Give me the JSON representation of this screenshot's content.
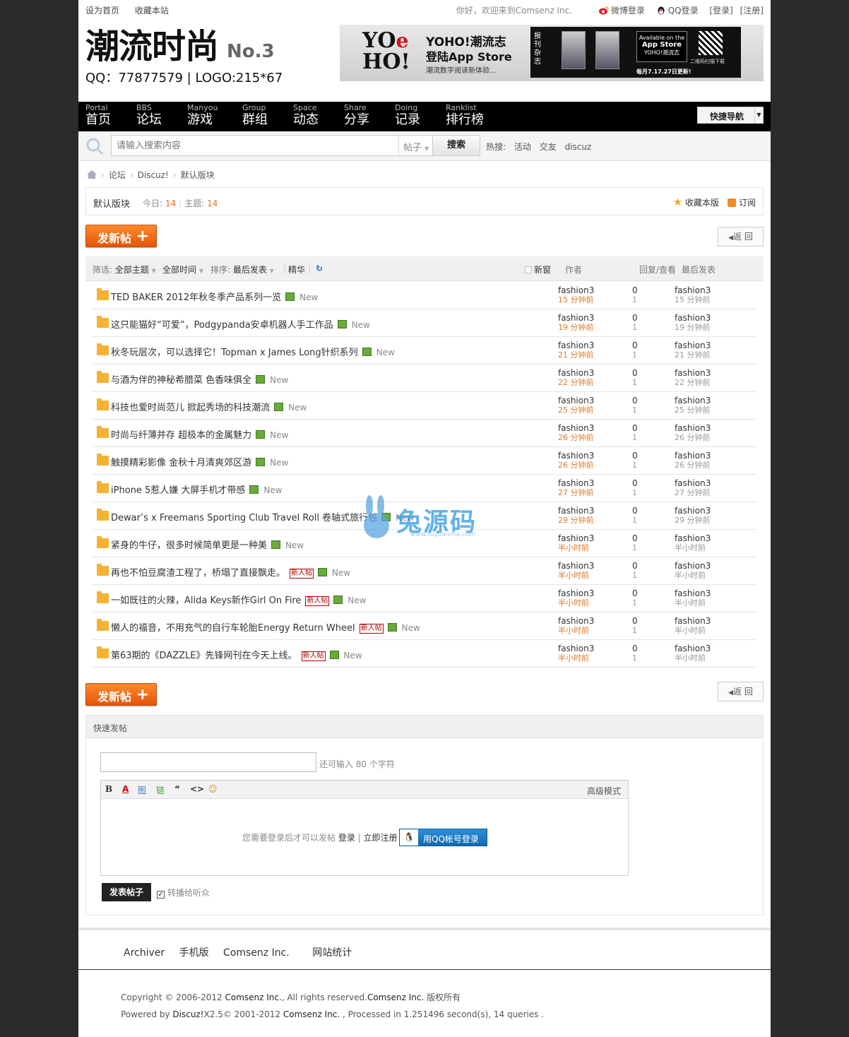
{
  "topbar": {
    "left": [
      "设为首页",
      "收藏本站"
    ],
    "greeting": "你好，欢迎来到Comsenz Inc.",
    "weibo": "微博登录",
    "qq": "QQ登录",
    "login": "[登录]",
    "register": "[注册]"
  },
  "header": {
    "logo_title": "潮流时尚",
    "logo_no": "No.3",
    "logo_sub": "QQ：77877579 | LOGO:215*67"
  },
  "banner": {
    "brand": "YOHO!",
    "line1": "YOHO!潮流志",
    "line2": "登陆App Store",
    "line3": "潮流数字阅读新体验...",
    "vertical": "报刊杂志",
    "app_top": "Available on the",
    "app_store": "App Store",
    "app_name": "YOHO!潮流志",
    "qr_text": "二维码扫描下载",
    "update": "每月7.17.27日更新!"
  },
  "nav": {
    "items": [
      {
        "en": "Portal",
        "cn": "首页"
      },
      {
        "en": "BBS",
        "cn": "论坛"
      },
      {
        "en": "Manyou",
        "cn": "游戏"
      },
      {
        "en": "Group",
        "cn": "群组"
      },
      {
        "en": "Space",
        "cn": "动态"
      },
      {
        "en": "Share",
        "cn": "分享"
      },
      {
        "en": "Doing",
        "cn": "记录"
      },
      {
        "en": "Ranklist",
        "cn": "排行榜"
      }
    ],
    "quick_nav": "快捷导航"
  },
  "search": {
    "placeholder": "请输入搜索内容",
    "type": "帖子",
    "button": "搜索",
    "hot_label": "热搜:",
    "hot": [
      "活动",
      "交友",
      "discuz"
    ]
  },
  "breadcrumb": [
    "论坛",
    "Discuz!",
    "默认版块"
  ],
  "forum": {
    "name": "默认版块",
    "today_label": "今日:",
    "today": "14",
    "threads_label": "主题:",
    "threads": "14",
    "favorite": "收藏本版",
    "subscribe": "订阅"
  },
  "buttons": {
    "new_post": "发新帖",
    "back": "返 回"
  },
  "list_header": {
    "filter_label": "筛选:",
    "filter_all": "全部主题",
    "time_all": "全部时间",
    "sort_label": "排序:",
    "sort_value": "最后发表",
    "digest": "精华",
    "new_window": "新窗",
    "author": "作者",
    "replies_views": "回复/查看",
    "last_post": "最后发表"
  },
  "threads": [
    {
      "title": "TED BAKER 2012年秋冬季产品系列一览",
      "newuser": "",
      "author": "fashion3",
      "time": "15 分钟前",
      "replies": "0",
      "views": "1",
      "last": "fashion3",
      "last_time": "15 分钟前"
    },
    {
      "title": "这只能猫好“可爱”，Podgypanda安卓机器人手工作品",
      "newuser": "",
      "author": "fashion3",
      "time": "19 分钟前",
      "replies": "0",
      "views": "1",
      "last": "fashion3",
      "last_time": "19 分钟前"
    },
    {
      "title": "秋冬玩层次，可以选择它！Topman x James Long针织系列",
      "newuser": "",
      "author": "fashion3",
      "time": "21 分钟前",
      "replies": "0",
      "views": "1",
      "last": "fashion3",
      "last_time": "21 分钟前"
    },
    {
      "title": "与酒为伴的神秘希腊菜 色香味俱全",
      "newuser": "",
      "author": "fashion3",
      "time": "22 分钟前",
      "replies": "0",
      "views": "1",
      "last": "fashion3",
      "last_time": "22 分钟前"
    },
    {
      "title": "科技也爱时尚范儿 掀起秀场的科技潮流",
      "newuser": "",
      "author": "fashion3",
      "time": "25 分钟前",
      "replies": "0",
      "views": "1",
      "last": "fashion3",
      "last_time": "25 分钟前"
    },
    {
      "title": "时尚与纤薄并存 超极本的金属魅力",
      "newuser": "",
      "author": "fashion3",
      "time": "26 分钟前",
      "replies": "0",
      "views": "1",
      "last": "fashion3",
      "last_time": "26 分钟前"
    },
    {
      "title": "触摸精彩影像 金秋十月清爽郊区游",
      "newuser": "",
      "author": "fashion3",
      "time": "26 分钟前",
      "replies": "0",
      "views": "1",
      "last": "fashion3",
      "last_time": "26 分钟前"
    },
    {
      "title": "iPhone 5惹人嫌 大屏手机才带感",
      "newuser": "",
      "author": "fashion3",
      "time": "27 分钟前",
      "replies": "0",
      "views": "1",
      "last": "fashion3",
      "last_time": "27 分钟前"
    },
    {
      "title": "Dewar’s x Freemans Sporting Club Travel Roll 卷轴式旅行包",
      "newuser": "",
      "author": "fashion3",
      "time": "29 分钟前",
      "replies": "0",
      "views": "1",
      "last": "fashion3",
      "last_time": "29 分钟前"
    },
    {
      "title": "紧身的牛仔，很多时候简单更是一种美",
      "newuser": "",
      "author": "fashion3",
      "time": "半小时前",
      "replies": "0",
      "views": "1",
      "last": "fashion3",
      "last_time": "半小时前"
    },
    {
      "title": "再也不怕豆腐渣工程了，桥塌了直接飘走。",
      "newuser": "新人帖",
      "author": "fashion3",
      "time": "半小时前",
      "replies": "0",
      "views": "1",
      "last": "fashion3",
      "last_time": "半小时前"
    },
    {
      "title": "一如既往的火辣，Alida Keys新作Girl On Fire",
      "newuser": "新人帖",
      "author": "fashion3",
      "time": "半小时前",
      "replies": "0",
      "views": "1",
      "last": "fashion3",
      "last_time": "半小时前"
    },
    {
      "title": "懒人的福音，不用充气的自行车轮胎Energy Return Wheel",
      "newuser": "新人帖",
      "author": "fashion3",
      "time": "半小时前",
      "replies": "0",
      "views": "1",
      "last": "fashion3",
      "last_time": "半小时前"
    },
    {
      "title": "第63期的《DAZZLE》先锋网刊在今天上线。",
      "newuser": "新人帖",
      "author": "fashion3",
      "time": "半小时前",
      "replies": "0",
      "views": "1",
      "last": "fashion3",
      "last_time": "半小时前"
    }
  ],
  "new_label": "New",
  "quick_post": {
    "title": "快速发帖",
    "remain": "还可输入 80 个字符",
    "toolbar": [
      "B",
      "A",
      "图",
      "链",
      "“",
      "<>",
      "☺"
    ],
    "advanced": "高级模式",
    "login_msg": "您需要登录后才可以发帖",
    "login": "登录",
    "register": "立即注册",
    "qq_login": "用QQ帐号登录",
    "submit": "发表帖子",
    "to_listeners": "转播给听众"
  },
  "footer": {
    "links": [
      "Archiver",
      "手机版",
      "Comsenz Inc.",
      "网站统计"
    ],
    "copyright_pre": "Copyright © 2006-2012",
    "copyright_company": "Comsenz Inc.",
    "copyright_mid": ", All rights reserved.",
    "copyright_owner": "Comsenz Inc.",
    "copyright_post": "版权所有",
    "powered_pre": "Powered by",
    "powered_product": "Discuz!",
    "powered_version": "X2.5© 2001-2012",
    "powered_company": "Comsenz Inc.",
    "powered_post": ", Processed in 1.251496 second(s), 14 queries ."
  },
  "watermark": {
    "text": "兔源码",
    "url": "www.tuyuanma.com"
  }
}
